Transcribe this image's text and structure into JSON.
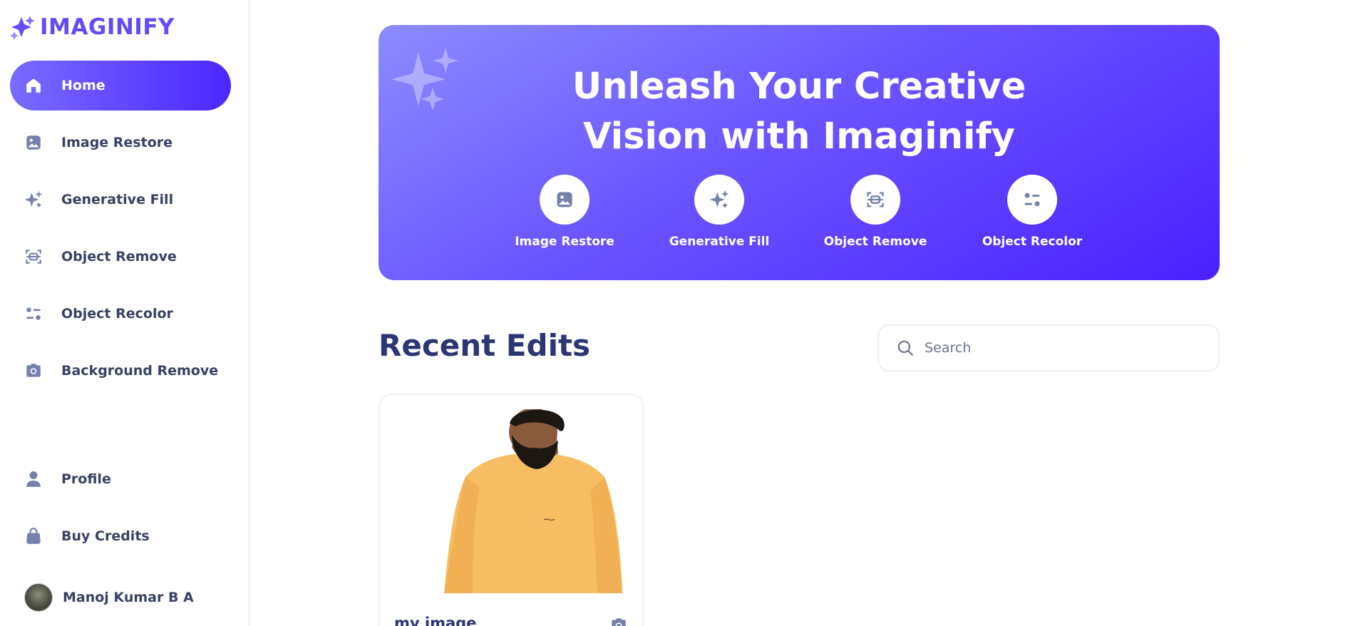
{
  "app": {
    "name": "IMAGINIFY",
    "brand_color": "#624cf5"
  },
  "sidebar": {
    "items": [
      {
        "label": "Home",
        "icon": "home-icon",
        "active": true
      },
      {
        "label": "Image Restore",
        "icon": "image-icon",
        "active": false
      },
      {
        "label": "Generative Fill",
        "icon": "stars-icon",
        "active": false
      },
      {
        "label": "Object Remove",
        "icon": "scan-icon",
        "active": false
      },
      {
        "label": "Object Recolor",
        "icon": "filter-icon",
        "active": false
      },
      {
        "label": "Background Remove",
        "icon": "camera-icon",
        "active": false
      }
    ],
    "bottom_items": [
      {
        "label": "Profile",
        "icon": "user-icon"
      },
      {
        "label": "Buy Credits",
        "icon": "bag-icon"
      }
    ],
    "user": {
      "name": "Manoj Kumar B A"
    }
  },
  "banner": {
    "title_line1": "Unleash Your Creative",
    "title_line2": "Vision with Imaginify",
    "actions": [
      {
        "label": "Image Restore",
        "icon": "image-icon"
      },
      {
        "label": "Generative Fill",
        "icon": "stars-icon"
      },
      {
        "label": "Object Remove",
        "icon": "scan-icon"
      },
      {
        "label": "Object Recolor",
        "icon": "filter-icon"
      }
    ]
  },
  "recent": {
    "title": "Recent Edits",
    "search_placeholder": "Search",
    "items": [
      {
        "title": "my image",
        "icon": "camera-icon"
      }
    ]
  }
}
